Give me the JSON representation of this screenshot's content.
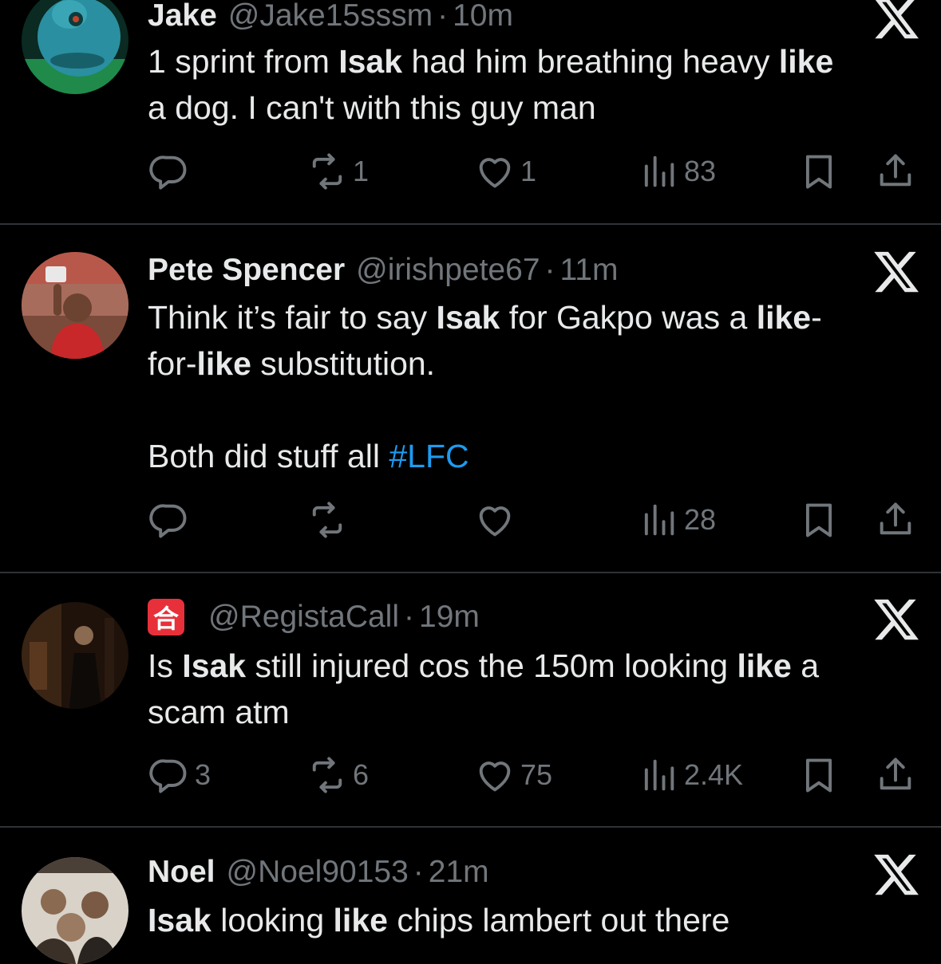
{
  "tweets": [
    {
      "display_name": "Jake",
      "handle": "@Jake15sssm",
      "separator": "·",
      "time": "10m",
      "text_lines": [
        [
          {
            "t": "1 sprint from ",
            "b": false
          },
          {
            "t": "Isak",
            "b": true
          },
          {
            "t": " had him breathing heavy ",
            "b": false
          },
          {
            "t": "like",
            "b": true
          }
        ],
        [
          {
            "t": "a dog. I can't with this guy man",
            "b": false
          }
        ]
      ],
      "replies": "",
      "retweets": "1",
      "likes": "1",
      "views": "83",
      "avatar": "green-monster-avatar",
      "avatar_colors": {
        "bg": "#1b6b52",
        "main": "#2a8fa0",
        "dark": "#0d3b3a"
      }
    },
    {
      "display_name": "Pete Spencer",
      "handle": "@irishpete67",
      "separator": "·",
      "time": "11m",
      "text_lines": [
        [
          {
            "t": "Think it’s fair to say ",
            "b": false
          },
          {
            "t": "Isak",
            "b": true
          },
          {
            "t": " for Gakpo was a ",
            "b": false
          },
          {
            "t": "like",
            "b": true
          },
          {
            "t": "-",
            "b": false
          }
        ],
        [
          {
            "t": "for-",
            "b": false
          },
          {
            "t": "like",
            "b": true
          },
          {
            "t": " substitution.",
            "b": false
          }
        ],
        [],
        [
          {
            "t": "Both did stuff all ",
            "b": false
          },
          {
            "t": "#LFC",
            "b": false,
            "tag": true
          }
        ]
      ],
      "replies": "",
      "retweets": "",
      "likes": "",
      "views": "28",
      "avatar": "stadium-selfie-avatar",
      "avatar_colors": {
        "bg": "#9a3b32",
        "main": "#c8282a",
        "dark": "#5a1a18"
      }
    },
    {
      "display_name": "",
      "badge_emoji": "合",
      "handle": "@RegistaCall",
      "separator": "·",
      "time": "19m",
      "text_lines": [
        [
          {
            "t": "Is ",
            "b": false
          },
          {
            "t": "Isak",
            "b": true
          },
          {
            "t": " still injured cos the 150m looking ",
            "b": false
          },
          {
            "t": "like",
            "b": true
          },
          {
            "t": " a",
            "b": false
          }
        ],
        [
          {
            "t": "scam atm",
            "b": false
          }
        ]
      ],
      "replies": "3",
      "retweets": "6",
      "likes": "75",
      "views": "2.4K",
      "avatar": "dark-suited-figure-avatar",
      "avatar_colors": {
        "bg": "#2b1a10",
        "main": "#5a3820",
        "dark": "#120b06"
      }
    },
    {
      "display_name": "Noel",
      "handle": "@Noel90153",
      "separator": "·",
      "time": "21m",
      "text_lines": [
        [
          {
            "t": "Isak",
            "b": true
          },
          {
            "t": " looking ",
            "b": false
          },
          {
            "t": "like",
            "b": true
          },
          {
            "t": " chips lambert out there",
            "b": false
          }
        ]
      ],
      "replies": "",
      "retweets": "",
      "likes": "",
      "views": "",
      "avatar": "group-photo-avatar",
      "avatar_colors": {
        "bg": "#d8d2c8",
        "main": "#8a7a68",
        "dark": "#3a3028"
      }
    }
  ],
  "colors": {
    "background": "#000000",
    "text": "#e7e9ea",
    "muted": "#71767b",
    "divider": "#2f3336",
    "hashtag": "#1d9bf0",
    "badge": "#e8303a"
  },
  "icons": {
    "close": "x-logo-icon",
    "reply": "reply-icon",
    "retweet": "retweet-icon",
    "like": "heart-icon",
    "views": "views-chart-icon",
    "bookmark": "bookmark-icon",
    "share": "share-icon"
  }
}
